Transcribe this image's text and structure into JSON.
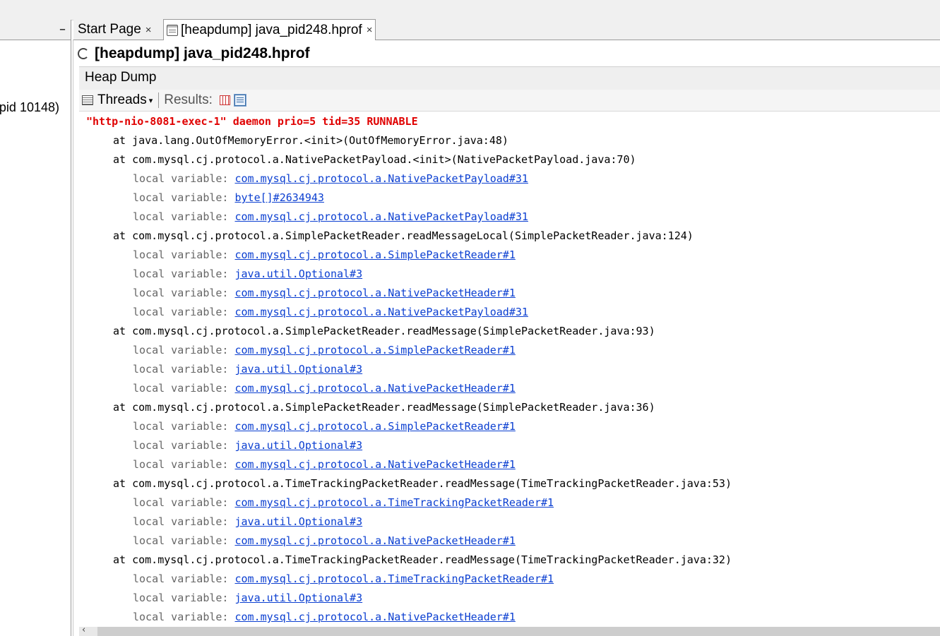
{
  "left_panel": {
    "minimize_label": "–",
    "item_text": "pid 10148)"
  },
  "tabs": [
    {
      "label": "Start Page",
      "close": "×"
    },
    {
      "label": "[heapdump] java_pid248.hprof",
      "close": "×"
    }
  ],
  "title": "[heapdump] java_pid248.hprof",
  "section_title": "Heap Dump",
  "toolbar": {
    "threads_label": "Threads",
    "results_label": "Results:"
  },
  "thread": {
    "header": "\"http-nio-8081-exec-1\" daemon prio=5 tid=35 RUNNABLE",
    "var_prefix": "local variable: "
  },
  "lines": [
    {
      "kind": "frame",
      "text": "at java.lang.OutOfMemoryError.<init>(OutOfMemoryError.java:48)"
    },
    {
      "kind": "frame",
      "text": "at com.mysql.cj.protocol.a.NativePacketPayload.<init>(NativePacketPayload.java:70)"
    },
    {
      "kind": "var",
      "text": "com.mysql.cj.protocol.a.NativePacketPayload#31"
    },
    {
      "kind": "var",
      "text": "byte[]#2634943"
    },
    {
      "kind": "var",
      "text": "com.mysql.cj.protocol.a.NativePacketPayload#31"
    },
    {
      "kind": "frame",
      "text": "at com.mysql.cj.protocol.a.SimplePacketReader.readMessageLocal(SimplePacketReader.java:124)"
    },
    {
      "kind": "var",
      "text": "com.mysql.cj.protocol.a.SimplePacketReader#1"
    },
    {
      "kind": "var",
      "text": "java.util.Optional#3"
    },
    {
      "kind": "var",
      "text": "com.mysql.cj.protocol.a.NativePacketHeader#1"
    },
    {
      "kind": "var",
      "text": "com.mysql.cj.protocol.a.NativePacketPayload#31"
    },
    {
      "kind": "frame",
      "text": "at com.mysql.cj.protocol.a.SimplePacketReader.readMessage(SimplePacketReader.java:93)"
    },
    {
      "kind": "var",
      "text": "com.mysql.cj.protocol.a.SimplePacketReader#1"
    },
    {
      "kind": "var",
      "text": "java.util.Optional#3"
    },
    {
      "kind": "var",
      "text": "com.mysql.cj.protocol.a.NativePacketHeader#1"
    },
    {
      "kind": "frame",
      "text": "at com.mysql.cj.protocol.a.SimplePacketReader.readMessage(SimplePacketReader.java:36)"
    },
    {
      "kind": "var",
      "text": "com.mysql.cj.protocol.a.SimplePacketReader#1"
    },
    {
      "kind": "var",
      "text": "java.util.Optional#3"
    },
    {
      "kind": "var",
      "text": "com.mysql.cj.protocol.a.NativePacketHeader#1"
    },
    {
      "kind": "frame",
      "text": "at com.mysql.cj.protocol.a.TimeTrackingPacketReader.readMessage(TimeTrackingPacketReader.java:53)"
    },
    {
      "kind": "var",
      "text": "com.mysql.cj.protocol.a.TimeTrackingPacketReader#1"
    },
    {
      "kind": "var",
      "text": "java.util.Optional#3"
    },
    {
      "kind": "var",
      "text": "com.mysql.cj.protocol.a.NativePacketHeader#1"
    },
    {
      "kind": "frame",
      "text": "at com.mysql.cj.protocol.a.TimeTrackingPacketReader.readMessage(TimeTrackingPacketReader.java:32)"
    },
    {
      "kind": "var",
      "text": "com.mysql.cj.protocol.a.TimeTrackingPacketReader#1"
    },
    {
      "kind": "var",
      "text": "java.util.Optional#3"
    },
    {
      "kind": "var",
      "text": "com.mysql.cj.protocol.a.NativePacketHeader#1"
    }
  ],
  "hscroll_arrow": "‹",
  "colors": {
    "thread_header": "#e00000",
    "link": "#0b3fd1",
    "var_label": "#666666"
  }
}
